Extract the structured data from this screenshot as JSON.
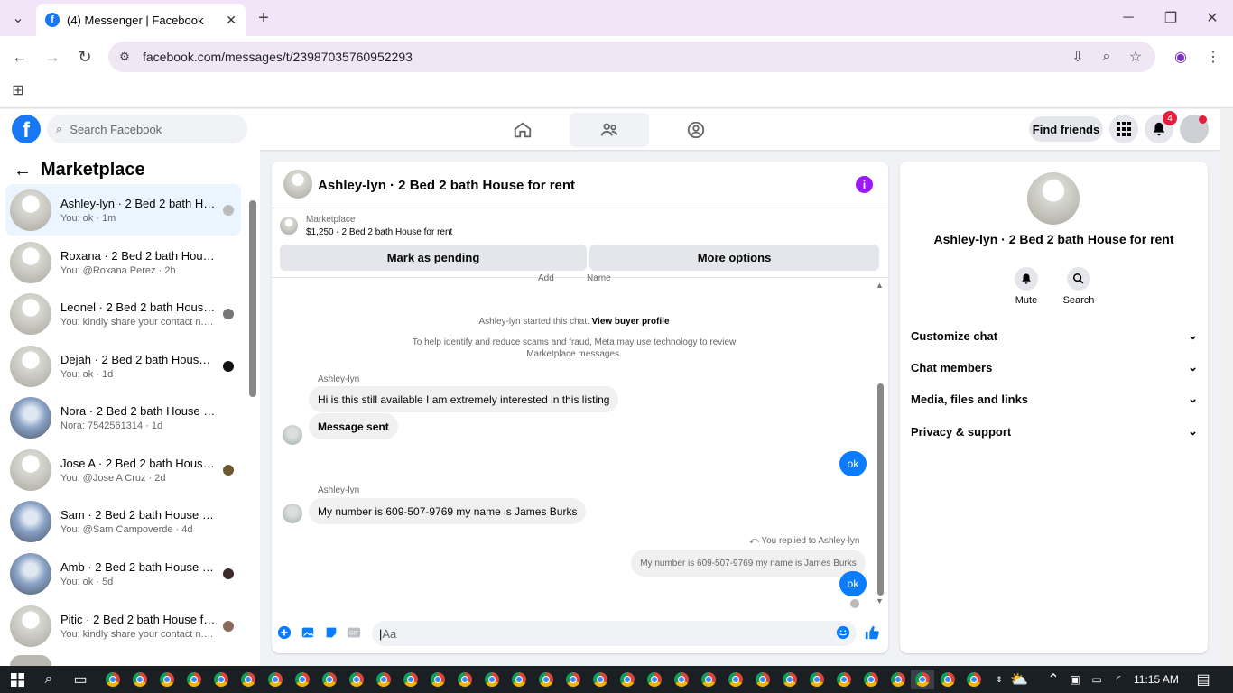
{
  "browser": {
    "tab_title": "(4) Messenger | Facebook",
    "url": "facebook.com/messages/t/23987035760952293"
  },
  "fb_header": {
    "search_placeholder": "Search Facebook",
    "find_friends": "Find friends",
    "notif_count": "4"
  },
  "marketplace": {
    "title": "Marketplace",
    "conversations": [
      {
        "title": "Ashley-lyn · 2 Bed 2 bath Ho...",
        "sub": "You: ok · 1m"
      },
      {
        "title": "Roxana · 2 Bed 2 bath House fo...",
        "sub": "You: @Roxana Perez · 2h"
      },
      {
        "title": "Leonel · 2 Bed 2 bath House f...",
        "sub": "You: kindly share your contact n... · 1d"
      },
      {
        "title": "Dejah · 2 Bed 2 bath House f...",
        "sub": "You: ok · 1d"
      },
      {
        "title": "Nora · 2 Bed 2 bath House for r...",
        "sub": "Nora: 7542561314 · 1d"
      },
      {
        "title": "Jose A · 2 Bed 2 bath House f...",
        "sub": "You: @Jose A Cruz · 2d"
      },
      {
        "title": "Sam · 2 Bed 2 bath House for re...",
        "sub": "You: @Sam Campoverde · 4d"
      },
      {
        "title": "Amb · 2 Bed 2 bath House fo...",
        "sub": "You: ok · 5d"
      },
      {
        "title": "Pitic · 2 Bed 2 bath House for...",
        "sub": "You: kindly share your contact n... · 5d"
      }
    ]
  },
  "chat": {
    "title": "Ashley-lyn · 2 Bed 2 bath House for rent",
    "marketplace_label": "Marketplace",
    "listing": "$1,250 - 2 Bed 2 bath House for rent",
    "mark_pending": "Mark as pending",
    "more_options": "More options",
    "cut_labels": [
      "Add",
      "Name"
    ],
    "started": "Ashley-lyn started this chat.",
    "view_profile": "View buyer profile",
    "notice_line1": "To help identify and reduce scams and fraud, Meta may use technology to review",
    "notice_line2": "Marketplace messages.",
    "sender": "Ashley-lyn",
    "msg1": "Hi is this still available I am extremely interested in this listing",
    "msg2": "Message sent",
    "reply1": "ok",
    "msg3": "My number is 609-507-9769 my name is James Burks",
    "replied_to": "You replied to Ashley-lyn",
    "quoted": "My number is 609-507-9769 my name is James Burks",
    "reply2": "ok",
    "composer_placeholder": "Aa"
  },
  "info_panel": {
    "title": "Ashley-lyn · 2 Bed 2 bath House for rent",
    "mute": "Mute",
    "search": "Search",
    "rows": [
      "Customize chat",
      "Chat members",
      "Media, files and links",
      "Privacy & support"
    ]
  },
  "taskbar": {
    "time": "11:15 AM"
  }
}
